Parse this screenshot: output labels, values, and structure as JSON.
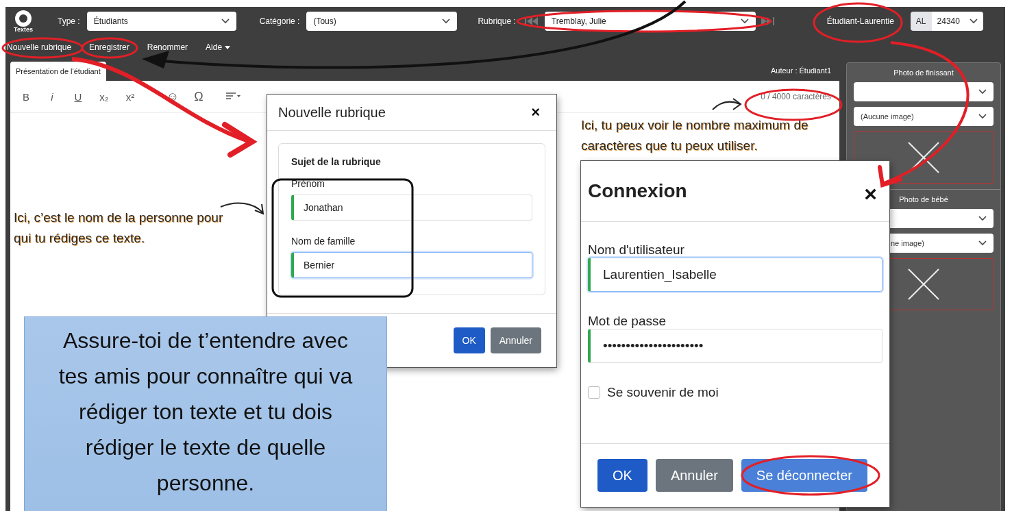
{
  "toolbar": {
    "logo_label": "Textes",
    "filters": [
      {
        "label": "Type :",
        "value": "Étudiants",
        "nav": false
      },
      {
        "label": "Catégorie :",
        "value": "(Tous)",
        "nav": false
      },
      {
        "label": "Rubrique :",
        "value": "Tremblay, Julie",
        "nav": true
      }
    ],
    "user": "Étudiant-Laurentie",
    "school": {
      "prefix": "AL",
      "value": "24340"
    }
  },
  "menu": [
    {
      "label": "Nouvelle rubrique",
      "dropdown": false
    },
    {
      "label": "Enregistrer",
      "dropdown": false
    },
    {
      "label": "Renommer",
      "dropdown": false
    },
    {
      "label": "Aide",
      "dropdown": true
    }
  ],
  "tabs": [
    {
      "label": "Présentation de l'étudiant",
      "selected": true
    }
  ],
  "author": "Auteur : Étudiant1",
  "editor": {
    "format_buttons": [
      "B",
      "i",
      "U",
      "x₂",
      "x²",
      "☺",
      "Ω"
    ],
    "counter": "0 / 4000 caractères"
  },
  "photos": [
    {
      "title": "Photo de finissant",
      "image_select": "(Aucune image)"
    },
    {
      "title": "Photo de bébé",
      "image_select": "ne image)"
    }
  ],
  "new_topic_dialog": {
    "title": "Nouvelle rubrique",
    "close": "×",
    "section": "Sujet de la rubrique",
    "fields": [
      {
        "label": "Prénom",
        "value": "Jonathan",
        "focused": false
      },
      {
        "label": "Nom de famille",
        "value": "Bernier",
        "focused": true
      }
    ],
    "buttons": [
      {
        "label": "OK",
        "kind": "primary"
      },
      {
        "label": "Annuler",
        "kind": "secondary"
      }
    ]
  },
  "login_dialog": {
    "title": "Connexion",
    "close": "×",
    "fields": [
      {
        "label": "Nom d'utilisateur",
        "value": "Laurentien_Isabelle",
        "focused": true
      },
      {
        "label": "Mot de passe",
        "value": "••••••••••••••••••••••",
        "focused": false
      }
    ],
    "remember": {
      "label": "Se souvenir de moi",
      "checked": false
    },
    "buttons": [
      {
        "label": "OK",
        "kind": "primary"
      },
      {
        "label": "Annuler",
        "kind": "secondary"
      },
      {
        "label": "Se déconnecter",
        "kind": "info"
      }
    ]
  },
  "annotations": [
    {
      "text": "Ici, c’est le nom de la personne pour qui tu rédiges ce texte."
    },
    {
      "text": "Ici, tu peux voir le nombre maximum de caractères que tu peux utiliser."
    }
  ],
  "note": "Assure-toi de t’entendre avec tes amis pour connaître qui va rédiger ton texte et tu dois rédiger le texte de quelle personne."
}
